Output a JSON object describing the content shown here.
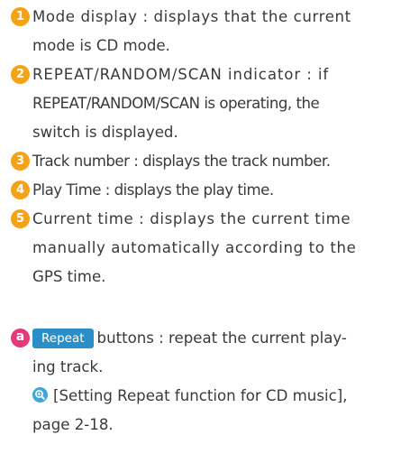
{
  "items": [
    {
      "num": "1",
      "lines": [
        "Mode display : displays that the current",
        "mode is CD mode."
      ]
    },
    {
      "num": "2",
      "lines": [
        "REPEAT/RANDOM/SCAN indicator : if",
        "REPEAT/RANDOM/SCAN is operating, the",
        "switch is displayed."
      ]
    },
    {
      "num": "3",
      "lines": [
        "Track number : displays the track number."
      ]
    },
    {
      "num": "4",
      "lines": [
        "Play Time : displays the play time."
      ]
    },
    {
      "num": "5",
      "lines": [
        "Current time : displays the current time",
        "manually automatically according to the",
        "GPS time."
      ]
    }
  ],
  "button_note": {
    "letter": "a",
    "button_label": "Repeat",
    "line1": "buttons : repeat the current play-",
    "line2": "ing track."
  },
  "reference": {
    "icon": "reference-icon",
    "line1": "[Setting Repeat function for CD music],",
    "line2": "page 2-18."
  }
}
